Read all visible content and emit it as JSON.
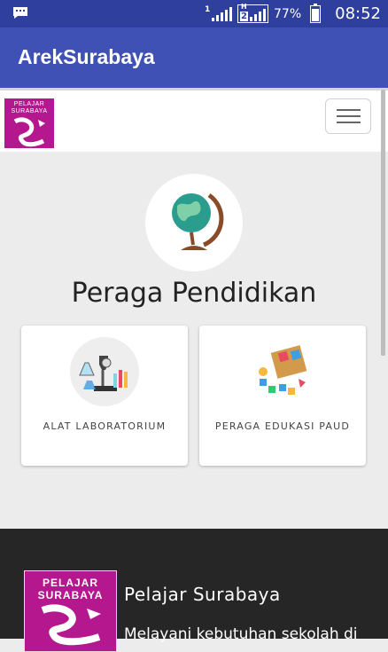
{
  "status_bar": {
    "battery_percent": "77%",
    "battery_level": 0.77,
    "time": "08:52",
    "network_type": "H",
    "sim_slot": "2",
    "sim1_label": "1",
    "icons": [
      "chat-notification-icon",
      "signal-icon",
      "signal-icon",
      "battery-icon"
    ]
  },
  "app_bar": {
    "title": "ArekSurabaya"
  },
  "navbar": {
    "logo_text_line1": "PELAJAR",
    "logo_text_line2": "SURABAYA",
    "menu_icon": "hamburger-icon"
  },
  "main": {
    "header_icon": "globe-icon",
    "title": "Peraga Pendidikan",
    "cards": [
      {
        "label": "ALAT LABORATORIUM",
        "icon": "laboratory-equipment-icon"
      },
      {
        "label": "PERAGA EDUKASI PAUD",
        "icon": "educational-toy-icon"
      }
    ]
  },
  "footer": {
    "logo_text_line1": "PELAJAR",
    "logo_text_line2": "SURABAYA",
    "title": "Pelajar Surabaya",
    "description": "Melayani kebutuhan sekolah di"
  },
  "colors": {
    "status_bar": "#2f3f9e",
    "app_bar": "#3f51b5",
    "brand_magenta": "#b5178e",
    "footer_bg": "#262626",
    "page_bg": "#ececec"
  }
}
